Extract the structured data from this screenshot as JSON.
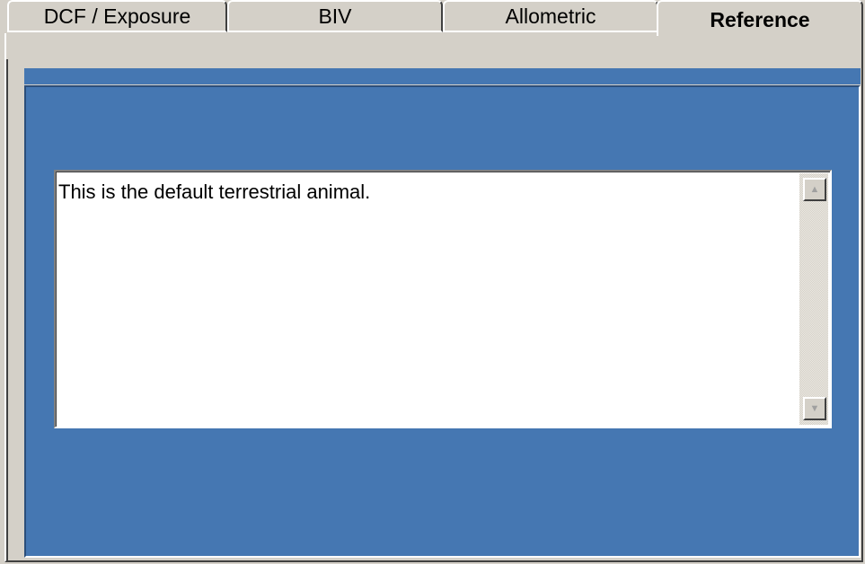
{
  "tabs": [
    {
      "label": "DCF / Exposure",
      "active": false
    },
    {
      "label": "BIV",
      "active": false
    },
    {
      "label": "Allometric",
      "active": false
    },
    {
      "label": "Reference",
      "active": true
    }
  ],
  "reference": {
    "text": "This is the default terrestrial animal."
  },
  "scrollbar": {
    "up_icon": "scroll-up-arrow",
    "down_icon": "scroll-down-arrow",
    "up_glyph": "▲",
    "down_glyph": "▼"
  },
  "colors": {
    "panel": "#4577b2",
    "window": "#d4d0c8"
  }
}
